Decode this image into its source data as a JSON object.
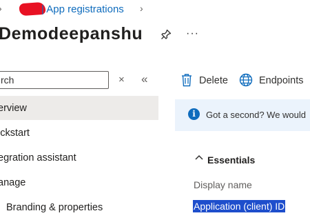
{
  "breadcrumb": {
    "separator": "|",
    "link": "App registrations",
    "chevron": "›"
  },
  "header": {
    "title": "Demodeepanshu",
    "more": "···",
    "pin_icon": "pin-icon"
  },
  "sidebar": {
    "search": {
      "value": "rch",
      "placeholder": "Search"
    },
    "clear_glyph": "×",
    "collapse_glyph": "«",
    "items": [
      {
        "label": "erview",
        "selected": true
      },
      {
        "label": "ickstart"
      },
      {
        "label": "egration assistant"
      },
      {
        "label": "anage"
      },
      {
        "label": "Branding & properties"
      }
    ]
  },
  "toolbar": {
    "delete_label": "Delete",
    "endpoints_label": "Endpoints"
  },
  "banner": {
    "text": "Got a second? We would"
  },
  "essentials": {
    "title": "Essentials",
    "display_name_label": "Display name",
    "app_id_label": "Application (client) ID"
  },
  "colors": {
    "link": "#0f6cbd",
    "selected_bg": "#edebe9",
    "banner_bg": "#ebf3fc",
    "selection_highlight": "#1e4ecc"
  }
}
